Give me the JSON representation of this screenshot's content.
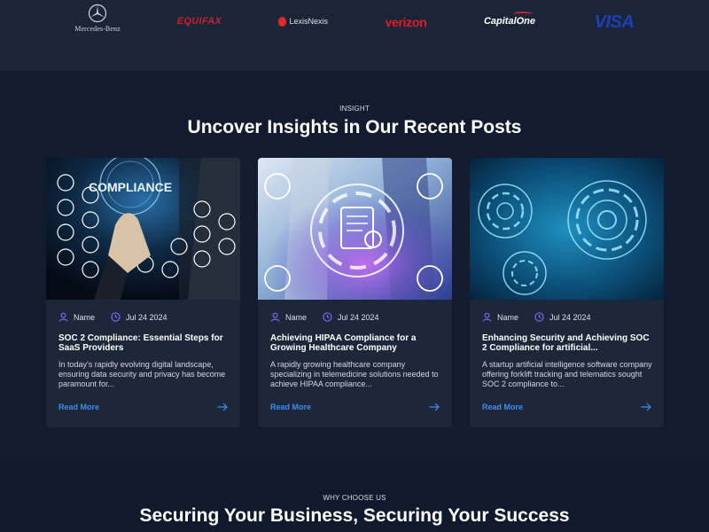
{
  "logos": {
    "mercedes": "Mercedes-Benz",
    "equifax": "EQUIFAX",
    "lexisnexis": "LexisNexis",
    "verizon": "verizon",
    "capitalone": "CapitalOne",
    "visa": "VISA"
  },
  "insight": {
    "eyebrow": "INSIGHT",
    "heading": "Uncover Insights in Our Recent Posts",
    "posts": [
      {
        "image_text": "COMPLIANCE",
        "author": "Name",
        "date": "Jul 24 2024",
        "title": "SOC 2 Compliance: Essential Steps for SaaS Providers",
        "excerpt": "In today's rapidly evolving digital landscape, ensuring data security and privacy has become paramount for...",
        "cta": "Read More"
      },
      {
        "author": "Name",
        "date": "Jul 24 2024",
        "title": "Achieving HIPAA Compliance for a Growing Healthcare Company",
        "excerpt": "A rapidly growing healthcare company specializing in telemedicine solutions needed to achieve HIPAA compliance...",
        "cta": "Read More"
      },
      {
        "author": "Name",
        "date": "Jul 24 2024",
        "title": "Enhancing Security and Achieving SOC 2 Compliance for artificial...",
        "excerpt": "A startup artificial intelligence software company offering forklift tracking and telematics sought SOC 2 compliance to...",
        "cta": "Read More"
      }
    ]
  },
  "why": {
    "eyebrow": "WHY CHOOSE US",
    "heading": "Securing Your Business, Securing Your Success"
  },
  "colors": {
    "page_bg": "#111a2c",
    "card_bg": "#1c2739",
    "accent_link": "#3f8cf0",
    "meta_icon": "#7b6cf0"
  },
  "icons": {
    "author": "user-icon",
    "date": "clock-icon",
    "cta": "arrow-right-icon"
  }
}
